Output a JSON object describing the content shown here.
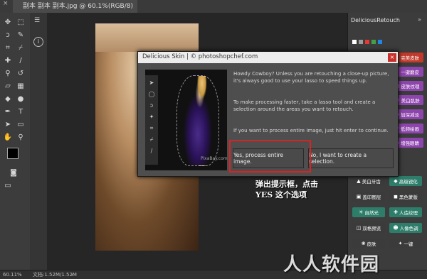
{
  "tab": {
    "title": "副本 副本 副本.jpg @ 60.1%(RGB/8)",
    "close": "×"
  },
  "status": {
    "zoom": "60.11%",
    "doc": "文档:1.52M/1.52M"
  },
  "right_panel": {
    "title": "DeliciousRetouch",
    "menu": "»",
    "buttons": [
      {
        "label": "完美皮肤",
        "color": "#c0392b",
        "icon": "star-icon"
      },
      {
        "label": "一键磨皮",
        "color": "#8e44ad",
        "icon": "brush-icon"
      },
      {
        "label": "皮肤纹理",
        "color": "#8e44ad",
        "icon": "texture-icon"
      },
      {
        "label": "美白肌肤",
        "color": "#8e44ad",
        "icon": "face-icon"
      },
      {
        "label": "加深减淡",
        "color": "#8e44ad",
        "icon": "dodge-icon"
      },
      {
        "label": "低频绘画",
        "color": "#8e44ad",
        "icon": "paint-icon"
      },
      {
        "label": "增强眼睛",
        "color": "#8e44ad",
        "icon": "eye-icon"
      }
    ],
    "grid": [
      {
        "label": "美白牙齿",
        "color": "#3b3b3b",
        "icon": "tooth-icon"
      },
      {
        "label": "高级锐化",
        "color": "#2e7d6a",
        "icon": "sharpen-icon"
      },
      {
        "label": "盖印图层",
        "color": "#3b3b3b",
        "icon": "stamp-icon"
      },
      {
        "label": "黑色蒙版",
        "color": "#3b3b3b",
        "icon": "mask-icon"
      },
      {
        "label": "自然光",
        "color": "#2e7d6a",
        "icon": "sun-icon"
      },
      {
        "label": "人造纹理",
        "color": "#2e7d6a",
        "icon": "cross-icon"
      },
      {
        "label": "双格预览",
        "color": "#3b3b3b",
        "icon": "compare-icon"
      },
      {
        "label": "人像色调",
        "color": "#2e7d6a",
        "icon": "portrait-icon"
      },
      {
        "label": "皮肤",
        "color": "#3b3b3b",
        "icon": "skin-icon"
      },
      {
        "label": "一键",
        "color": "#3b3b3b",
        "icon": "wand-icon"
      }
    ]
  },
  "dialog": {
    "title": "Delicious Skin | © photoshopchef.com",
    "close": "×",
    "para1": "Howdy Cowboy? Unless you are retouching a close-up picture, it's always good to use your lasso to speed things up.",
    "para2": "To make processing faster, take a lasso tool and create a selection around the areas you want to retouch.",
    "para3": "If you want to process entire image, just hit enter to continue.",
    "btn_yes": "Yes, process entire image.",
    "btn_no": "No, I want to create a selection.",
    "image_credit": "PixaBay.com"
  },
  "annotation": {
    "line1": "弹出提示框，点击",
    "line2": "YES 这个选项"
  },
  "watermark": "人人软件园"
}
